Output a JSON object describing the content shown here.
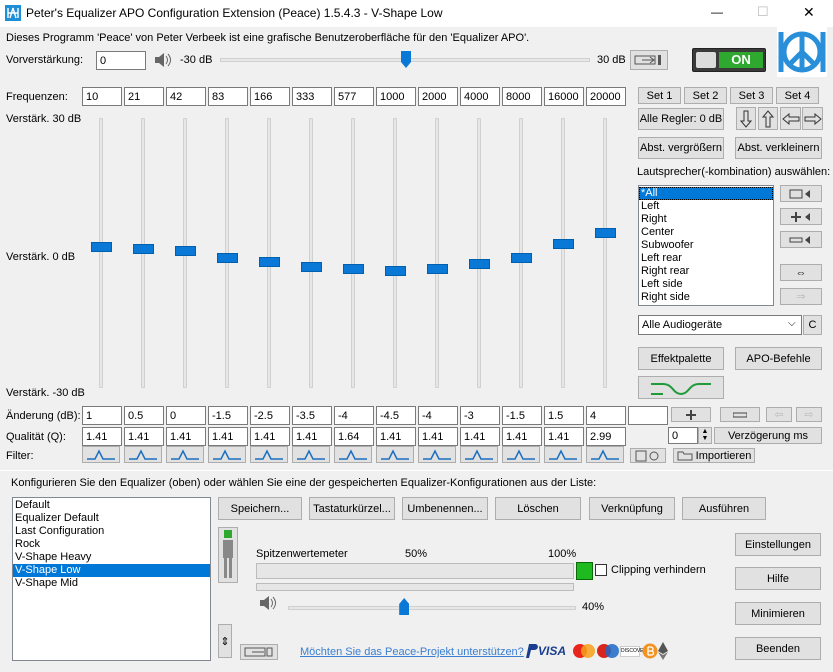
{
  "window": {
    "title": "Peter's Equalizer APO Configuration Extension (Peace) 1.5.4.3 - V-Shape Low",
    "minimize": "—",
    "maximize": "☐",
    "close": "✕"
  },
  "intro": "Dieses Programm 'Peace' von Peter Verbeek ist eine grafische Benutzeroberfläche für den 'Equalizer APO'.",
  "preamp": {
    "label": "Vorverstärkung:",
    "value": "0",
    "min_label": "-30 dB",
    "max_label": "30 dB",
    "level_db": 0
  },
  "power": {
    "label": "ON"
  },
  "freq_label": "Frequenzen:",
  "frequencies": [
    "10",
    "21",
    "42",
    "83",
    "166",
    "333",
    "577",
    "1000",
    "2000",
    "4000",
    "8000",
    "16000",
    "20000"
  ],
  "gain_top": "Verstärk. 30 dB",
  "gain_mid": "Verstärk. 0 dB",
  "gain_bot": "Verstärk. -30 dB",
  "gains_label": "Änderung (dB):",
  "gains": [
    "1",
    "0.5",
    "0",
    "-1.5",
    "-2.5",
    "-3.5",
    "-4",
    "-4.5",
    "-4",
    "-3",
    "-1.5",
    "1.5",
    "4",
    ""
  ],
  "q_label": "Qualität (Q):",
  "qualities": [
    "1.41",
    "1.41",
    "1.41",
    "1.41",
    "1.41",
    "1.41",
    "1.64",
    "1.41",
    "1.41",
    "1.41",
    "1.41",
    "1.41",
    "2.99"
  ],
  "filter_label": "Filter:",
  "sets": [
    "Set 1",
    "Set 2",
    "Set 3",
    "Set 4"
  ],
  "all_sliders": "Alle Regler: 0 dB",
  "enlarge": "Abst. vergrößern",
  "shrink": "Abst. verkleinern",
  "speaker_label": "Lautsprecher(-kombination) auswählen:",
  "speakers": [
    "*All",
    "Left",
    "Right",
    "Center",
    "Subwoofer",
    "Left rear",
    "Right rear",
    "Left side",
    "Right side"
  ],
  "device": "Alle Audiogeräte",
  "device_c": "C",
  "effects": "Effektpalette",
  "apo_commands": "APO-Befehle",
  "delay_value": "0",
  "delay_label": "Verzögerung ms",
  "import": "Importieren",
  "config_prompt": "Konfigurieren Sie den Equalizer (oben) oder wählen Sie eine der gespeicherten Equalizer-Konfigurationen aus der Liste:",
  "configs": [
    "Default",
    "Equalizer Default",
    "Last Configuration",
    "Rock",
    "V-Shape Heavy",
    "V-Shape Low",
    "V-Shape Mid"
  ],
  "selected_config": "V-Shape Low",
  "actions": [
    "Speichern...",
    "Tastaturkürzel...",
    "Umbenennen...",
    "Löschen",
    "Verknüpfung",
    "Ausführen"
  ],
  "side_buttons": [
    "Einstellungen",
    "Hilfe",
    "Minimieren",
    "Beenden"
  ],
  "meter": {
    "label": "Spitzenwertemeter",
    "p50": "50%",
    "p100": "100%",
    "clip": "Clipping verhindern",
    "volume": "40%",
    "volume_level": 40
  },
  "support": "Möchten Sie das Peace-Projekt unterstützen?",
  "colors": {
    "accent": "#0a78d7",
    "power": "#2fa82f"
  }
}
